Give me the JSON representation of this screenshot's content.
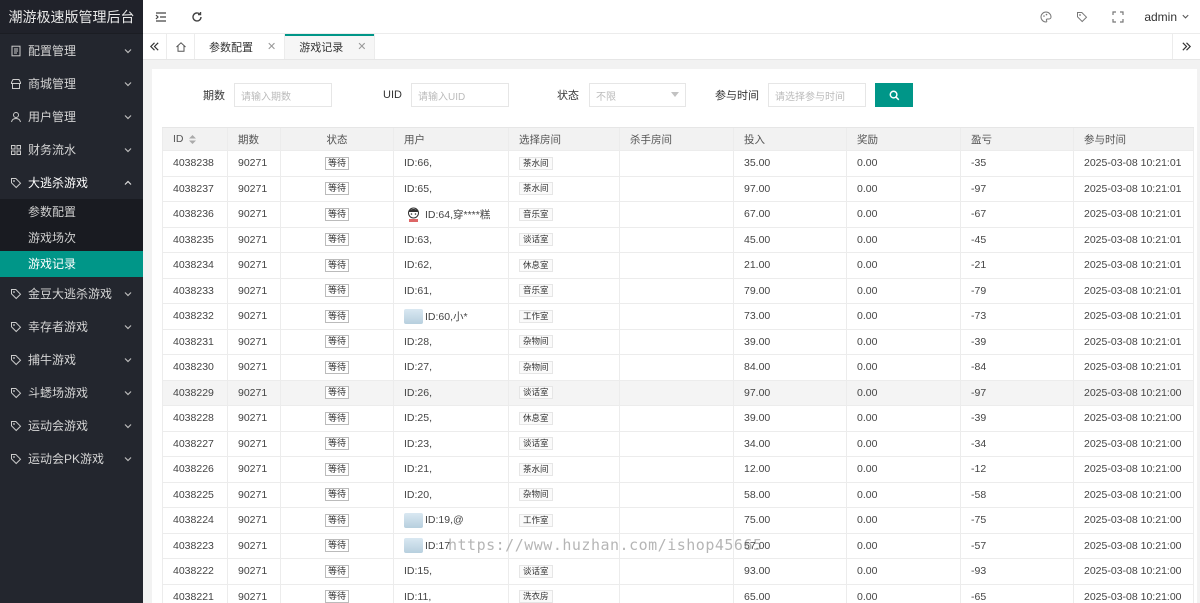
{
  "app": {
    "title": "潮游极速版管理后台"
  },
  "sidebar": {
    "items": [
      {
        "label": "配置管理",
        "icon": "document-icon"
      },
      {
        "label": "商城管理",
        "icon": "shop-icon"
      },
      {
        "label": "用户管理",
        "icon": "user-icon"
      },
      {
        "label": "财务流水",
        "icon": "grid-icon"
      },
      {
        "label": "大逃杀游戏",
        "icon": "tag-icon",
        "open": true,
        "children": [
          {
            "label": "参数配置"
          },
          {
            "label": "游戏场次"
          },
          {
            "label": "游戏记录",
            "active": true
          }
        ]
      },
      {
        "label": "金豆大逃杀游戏",
        "icon": "tag-icon"
      },
      {
        "label": "幸存者游戏",
        "icon": "tag-icon"
      },
      {
        "label": "捕牛游戏",
        "icon": "tag-icon"
      },
      {
        "label": "斗蟋场游戏",
        "icon": "tag-icon"
      },
      {
        "label": "运动会游戏",
        "icon": "tag-icon"
      },
      {
        "label": "运动会PK游戏",
        "icon": "tag-icon"
      }
    ]
  },
  "header": {
    "user": "admin"
  },
  "tabs": [
    {
      "label": "参数配置"
    },
    {
      "label": "游戏记录",
      "active": true
    }
  ],
  "filters": {
    "period_label": "期数",
    "period_placeholder": "请输入期数",
    "uid_label": "UID",
    "uid_placeholder": "请输入UID",
    "status_label": "状态",
    "status_value": "不限",
    "time_label": "参与时间",
    "time_placeholder": "请选择参与时间"
  },
  "table": {
    "columns": [
      "ID",
      "期数",
      "状态",
      "用户",
      "选择房间",
      "杀手房间",
      "投入",
      "奖励",
      "盈亏",
      "参与时间"
    ],
    "rows": [
      {
        "id": "4038238",
        "period": "90271",
        "status": "等待",
        "user": "ID:66,",
        "avatar": "",
        "room": "茶水间",
        "killer": "",
        "invest": "35.00",
        "reward": "0.00",
        "profit": "-35",
        "time": "2025-03-08 10:21:01"
      },
      {
        "id": "4038237",
        "period": "90271",
        "status": "等待",
        "user": "ID:65,",
        "avatar": "",
        "room": "茶水间",
        "killer": "",
        "invest": "97.00",
        "reward": "0.00",
        "profit": "-97",
        "time": "2025-03-08 10:21:01"
      },
      {
        "id": "4038236",
        "period": "90271",
        "status": "等待",
        "user": "ID:64,穿****糕",
        "avatar": "cartoon",
        "room": "音乐室",
        "killer": "",
        "invest": "67.00",
        "reward": "0.00",
        "profit": "-67",
        "time": "2025-03-08 10:21:01"
      },
      {
        "id": "4038235",
        "period": "90271",
        "status": "等待",
        "user": "ID:63,",
        "avatar": "",
        "room": "谈话室",
        "killer": "",
        "invest": "45.00",
        "reward": "0.00",
        "profit": "-45",
        "time": "2025-03-08 10:21:01"
      },
      {
        "id": "4038234",
        "period": "90271",
        "status": "等待",
        "user": "ID:62,",
        "avatar": "",
        "room": "休息室",
        "killer": "",
        "invest": "21.00",
        "reward": "0.00",
        "profit": "-21",
        "time": "2025-03-08 10:21:01"
      },
      {
        "id": "4038233",
        "period": "90271",
        "status": "等待",
        "user": "ID:61,",
        "avatar": "",
        "room": "音乐室",
        "killer": "",
        "invest": "79.00",
        "reward": "0.00",
        "profit": "-79",
        "time": "2025-03-08 10:21:01"
      },
      {
        "id": "4038232",
        "period": "90271",
        "status": "等待",
        "user": "ID:60,小*",
        "avatar": "photo",
        "room": "工作室",
        "killer": "",
        "invest": "73.00",
        "reward": "0.00",
        "profit": "-73",
        "time": "2025-03-08 10:21:01"
      },
      {
        "id": "4038231",
        "period": "90271",
        "status": "等待",
        "user": "ID:28,",
        "avatar": "",
        "room": "杂物间",
        "killer": "",
        "invest": "39.00",
        "reward": "0.00",
        "profit": "-39",
        "time": "2025-03-08 10:21:01"
      },
      {
        "id": "4038230",
        "period": "90271",
        "status": "等待",
        "user": "ID:27,",
        "avatar": "",
        "room": "杂物间",
        "killer": "",
        "invest": "84.00",
        "reward": "0.00",
        "profit": "-84",
        "time": "2025-03-08 10:21:01"
      },
      {
        "id": "4038229",
        "period": "90271",
        "status": "等待",
        "user": "ID:26,",
        "avatar": "",
        "room": "谈话室",
        "killer": "",
        "invest": "97.00",
        "reward": "0.00",
        "profit": "-97",
        "time": "2025-03-08 10:21:00",
        "highlight": true
      },
      {
        "id": "4038228",
        "period": "90271",
        "status": "等待",
        "user": "ID:25,",
        "avatar": "",
        "room": "休息室",
        "killer": "",
        "invest": "39.00",
        "reward": "0.00",
        "profit": "-39",
        "time": "2025-03-08 10:21:00"
      },
      {
        "id": "4038227",
        "period": "90271",
        "status": "等待",
        "user": "ID:23,",
        "avatar": "",
        "room": "谈话室",
        "killer": "",
        "invest": "34.00",
        "reward": "0.00",
        "profit": "-34",
        "time": "2025-03-08 10:21:00"
      },
      {
        "id": "4038226",
        "period": "90271",
        "status": "等待",
        "user": "ID:21,",
        "avatar": "",
        "room": "茶水间",
        "killer": "",
        "invest": "12.00",
        "reward": "0.00",
        "profit": "-12",
        "time": "2025-03-08 10:21:00"
      },
      {
        "id": "4038225",
        "period": "90271",
        "status": "等待",
        "user": "ID:20,",
        "avatar": "",
        "room": "杂物间",
        "killer": "",
        "invest": "58.00",
        "reward": "0.00",
        "profit": "-58",
        "time": "2025-03-08 10:21:00"
      },
      {
        "id": "4038224",
        "period": "90271",
        "status": "等待",
        "user": "ID:19,@",
        "avatar": "photo",
        "room": "工作室",
        "killer": "",
        "invest": "75.00",
        "reward": "0.00",
        "profit": "-75",
        "time": "2025-03-08 10:21:00"
      },
      {
        "id": "4038223",
        "period": "90271",
        "status": "等待",
        "user": "ID:17",
        "avatar": "photo",
        "room": "",
        "killer": "",
        "invest": "57.00",
        "reward": "0.00",
        "profit": "-57",
        "time": "2025-03-08 10:21:00"
      },
      {
        "id": "4038222",
        "period": "90271",
        "status": "等待",
        "user": "ID:15,",
        "avatar": "",
        "room": "谈话室",
        "killer": "",
        "invest": "93.00",
        "reward": "0.00",
        "profit": "-93",
        "time": "2025-03-08 10:21:00"
      },
      {
        "id": "4038221",
        "period": "90271",
        "status": "等待",
        "user": "ID:11,",
        "avatar": "",
        "room": "洗衣房",
        "killer": "",
        "invest": "65.00",
        "reward": "0.00",
        "profit": "-65",
        "time": "2025-03-08 10:21:00"
      }
    ]
  },
  "watermark": "https://www.huzhan.com/ishop45665",
  "colors": {
    "accent": "#009688",
    "sidebar": "#23262e"
  }
}
